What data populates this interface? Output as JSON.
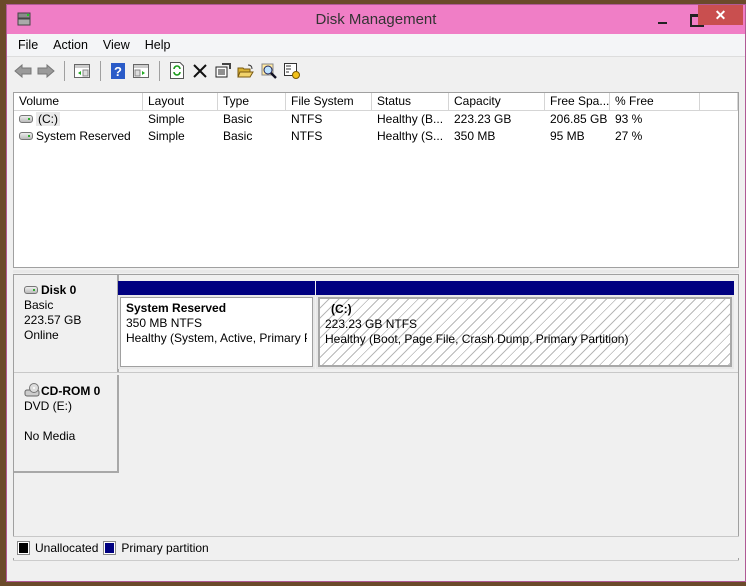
{
  "window": {
    "title": "Disk Management",
    "close": "✕"
  },
  "menu": [
    "File",
    "Action",
    "View",
    "Help"
  ],
  "toolbar": [
    "back",
    "forward",
    "show-hide-console-tree",
    "help",
    "show-hide-action-pane",
    "refresh",
    "delete",
    "properties",
    "open",
    "explore",
    "settings"
  ],
  "volumes": {
    "columns": [
      "Volume",
      "Layout",
      "Type",
      "File System",
      "Status",
      "Capacity",
      "Free Spa...",
      "% Free",
      ""
    ],
    "rows": [
      [
        "(C:)",
        "Simple",
        "Basic",
        "NTFS",
        "Healthy (B...",
        "223.23 GB",
        "206.85 GB",
        "93 %"
      ],
      [
        "System Reserved",
        "Simple",
        "Basic",
        "NTFS",
        "Healthy (S...",
        "350 MB",
        "95 MB",
        "27 %"
      ]
    ]
  },
  "disks": [
    {
      "name": "Disk 0",
      "type": "Basic",
      "size": "223.57 GB",
      "status": "Online",
      "partitions": [
        {
          "name": "System Reserved",
          "size": "350 MB NTFS",
          "status": "Healthy (System, Active, Primary P"
        },
        {
          "name": "(C:)",
          "size": "223.23 GB NTFS",
          "status": "Healthy (Boot, Page File, Crash Dump, Primary Partition)"
        }
      ]
    },
    {
      "name": "CD-ROM 0",
      "type": "DVD (E:)",
      "media": "No Media"
    }
  ],
  "legend": [
    {
      "label": "Unallocated",
      "color": "#000000"
    },
    {
      "label": "Primary partition",
      "color": "#000080"
    }
  ]
}
